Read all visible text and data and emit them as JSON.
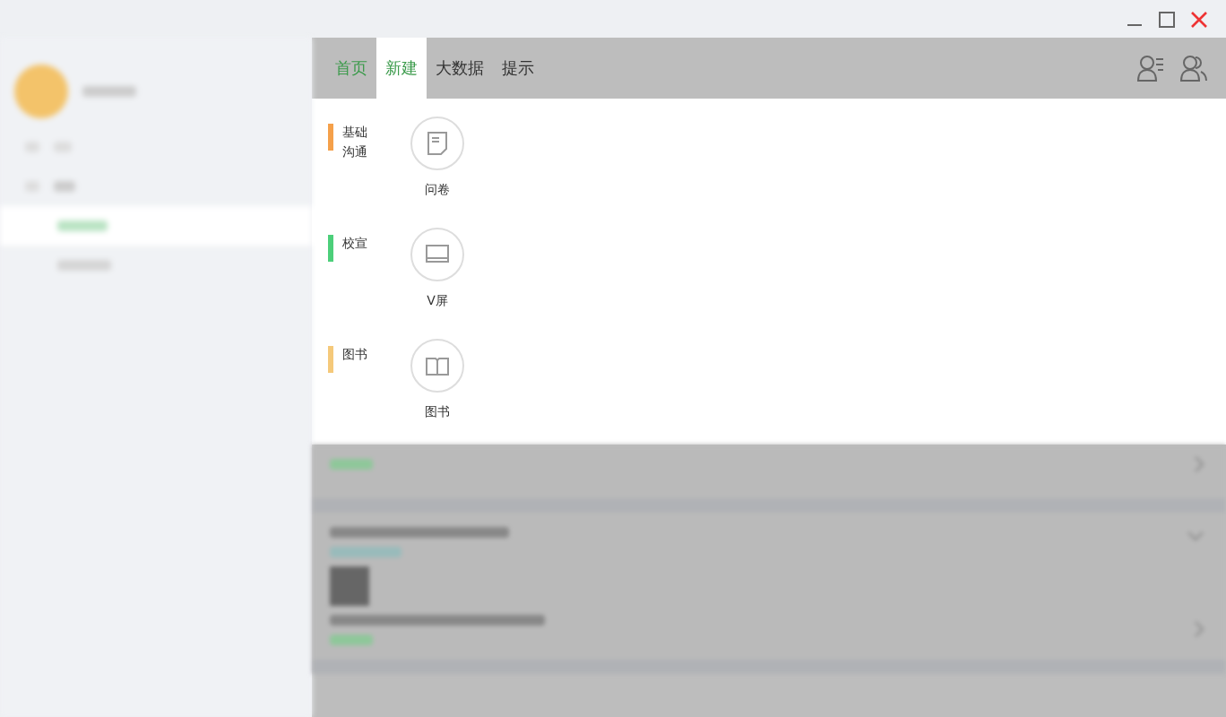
{
  "tabs": [
    {
      "label": "首页",
      "selected": false,
      "color": "#3a9a4a"
    },
    {
      "label": "新建",
      "selected": true,
      "color": "#3a9a4a"
    },
    {
      "label": "大数据",
      "selected": false,
      "color": "#333333"
    },
    {
      "label": "提示",
      "selected": false,
      "color": "#333333"
    }
  ],
  "sections": [
    {
      "label": "基础沟通",
      "color": "#f5a04a",
      "items": [
        {
          "label": "问卷",
          "kind": "document"
        }
      ]
    },
    {
      "label": "校宣",
      "color": "#4ccf7a",
      "items": [
        {
          "label": "V屏",
          "kind": "screen"
        }
      ]
    },
    {
      "label": "图书",
      "color": "#f5c97a",
      "items": [
        {
          "label": "图书",
          "kind": "book"
        }
      ]
    }
  ]
}
